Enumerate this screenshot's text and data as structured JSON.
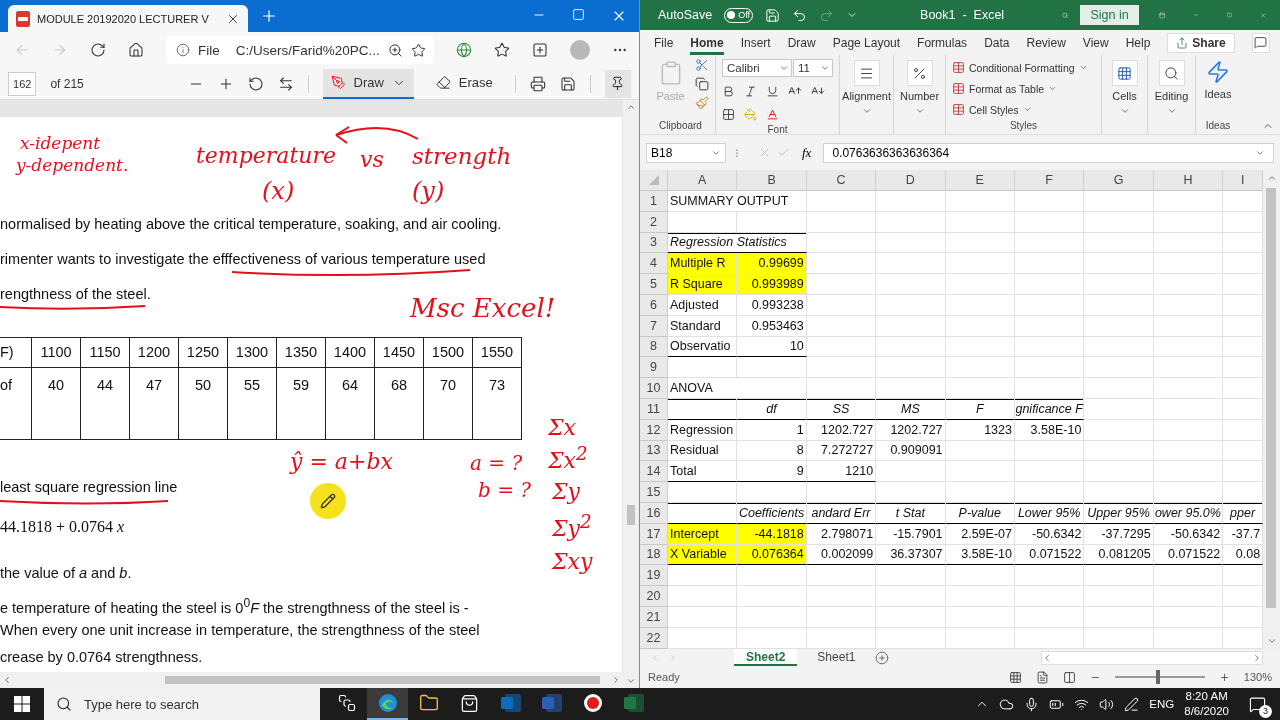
{
  "browser": {
    "tab": {
      "title": "MODULE 20192020 LECTURER V",
      "selected": true
    },
    "nav": {
      "back_disabled": true,
      "forward_disabled": true
    },
    "address": {
      "scheme": "File",
      "url": "C:/Users/Farid%20PC..."
    },
    "pdf_toolbar": {
      "page": "162",
      "page_count": "of 215",
      "tools": [
        {
          "label": "Draw",
          "selected": true
        },
        {
          "label": "Erase",
          "selected": false
        }
      ],
      "pinned": true
    },
    "page": {
      "lines_before_table": [
        "normalised by heating above the critical temperature, soaking, and air cooling.",
        "rimenter wants to investigate the efffectiveness of various temperature used",
        "rengthness of the steel."
      ],
      "table": [
        [
          "F)",
          "1100",
          "1150",
          "1200",
          "1250",
          "1300",
          "1350",
          "1400",
          "1450",
          "1500",
          "1550"
        ],
        [
          "of",
          "40",
          "44",
          "47",
          "50",
          "55",
          "59",
          "64",
          "68",
          "70",
          "73"
        ]
      ],
      "lines_after_table": [
        {
          "kind": "text",
          "text": "least square regression line"
        },
        {
          "kind": "formula",
          "text": "44.1818 + 0.0764 *x*"
        },
        {
          "kind": "text",
          "text": "the value of *a* and *b*."
        },
        {
          "kind": "text",
          "text": "e temperature of heating the steel is  0$^{0}$*F* the strengthness of the steel is -"
        },
        {
          "kind": "text",
          "text": "When every one unit increase in temperature, the strengthness of the steel"
        },
        {
          "kind": "text",
          "text": "crease by 0.0764 strengthness."
        }
      ],
      "ink": [
        "x-idepent",
        "y-dependent.",
        "temperature",
        "vs",
        "strength",
        "(x)",
        "(y)",
        "Msc Excel!",
        "ŷ = a+bx",
        "a = ?",
        "b = ?",
        "Σx",
        "Σx$^{2}$",
        "Σy",
        "Σy$^{2}$",
        "Σxy"
      ]
    }
  },
  "excel": {
    "title_bar": {
      "autosave": "AutoSave",
      "autosave_on": false,
      "autosave_state": "Off",
      "redo_disabled": true,
      "title": "Book1  -  Excel",
      "sign_in": "Sign in"
    },
    "ribbon_tabs": [
      {
        "label": "File",
        "selected": false
      },
      {
        "label": "Home",
        "selected": true
      },
      {
        "label": "Insert",
        "selected": false
      },
      {
        "label": "Draw",
        "selected": false
      },
      {
        "label": "Page Layout",
        "selected": false
      },
      {
        "label": "Formulas",
        "selected": false
      },
      {
        "label": "Data",
        "selected": false
      },
      {
        "label": "Review",
        "selected": false
      },
      {
        "label": "View",
        "selected": false
      },
      {
        "label": "Help",
        "selected": false
      }
    ],
    "share": "Share",
    "ribbon": {
      "paste": "Paste",
      "paste_disabled": true,
      "font": "Calibri",
      "size": "11",
      "alignment": "Alignment",
      "number": "Number",
      "styles": [
        "Conditional Formatting",
        "Format as Table",
        "Cell Styles"
      ],
      "cells": "Cells",
      "editing": "Editing",
      "ideas": "Ideas",
      "groups": [
        "Clipboard",
        "Font",
        "Styles",
        "Ideas"
      ]
    },
    "formula_bar": {
      "name_box": "B18",
      "fx": "fx",
      "formula": "0.0763636363636364"
    },
    "columns": [
      "A",
      "B",
      "C",
      "D",
      "E",
      "F",
      "G",
      "H",
      "I"
    ],
    "rows": [
      {
        "number": "1",
        "kind": "title",
        "highlight": false,
        "border_top": false,
        "border_bottom": false,
        "a": "SUMMARY OUTPUT"
      },
      {
        "number": "2",
        "kind": "blank",
        "highlight": false,
        "border_top": false,
        "border_bottom": false
      },
      {
        "number": "3",
        "kind": "italic-title",
        "highlight": false,
        "border_top": true,
        "border_bottom": true,
        "a": "Regression Statistics"
      },
      {
        "number": "4",
        "kind": "data",
        "highlight": true,
        "border_top": false,
        "border_bottom": false,
        "a": "Multiple R",
        "b": "0.99699"
      },
      {
        "number": "5",
        "kind": "data",
        "highlight": true,
        "border_top": false,
        "border_bottom": false,
        "a": "R Square",
        "b": "0.993989"
      },
      {
        "number": "6",
        "kind": "data",
        "highlight": false,
        "border_top": false,
        "border_bottom": false,
        "a": "Adjusted",
        "b": "0.993238"
      },
      {
        "number": "7",
        "kind": "data",
        "highlight": false,
        "border_top": false,
        "border_bottom": false,
        "a": "Standard",
        "b": "0.953463"
      },
      {
        "number": "8",
        "kind": "data",
        "highlight": false,
        "border_top": false,
        "border_bottom": true,
        "a": "Observatio",
        "b": "10"
      },
      {
        "number": "9",
        "kind": "blank",
        "highlight": false,
        "border_top": false,
        "border_bottom": false
      },
      {
        "number": "10",
        "kind": "title",
        "highlight": false,
        "border_top": false,
        "border_bottom": false,
        "a": "ANOVA"
      },
      {
        "number": "11",
        "kind": "header",
        "highlight": false,
        "border_top": true,
        "border_bottom": true,
        "b": "df",
        "c": "SS",
        "d": "MS",
        "e": "F",
        "f": "gnificance F"
      },
      {
        "number": "12",
        "kind": "data",
        "highlight": false,
        "border_top": false,
        "border_bottom": false,
        "a": "Regression",
        "b": "1",
        "c": "1202.727",
        "d": "1202.727",
        "e": "1323",
        "f": "3.58E-10"
      },
      {
        "number": "13",
        "kind": "data",
        "highlight": false,
        "border_top": false,
        "border_bottom": false,
        "a": "Residual",
        "b": "8",
        "c": "7.272727",
        "d": "0.909091"
      },
      {
        "number": "14",
        "kind": "data",
        "highlight": false,
        "border_top": false,
        "border_bottom": true,
        "a": "Total",
        "b": "9",
        "c": "1210"
      },
      {
        "number": "15",
        "kind": "blank",
        "highlight": false,
        "border_top": false,
        "border_bottom": false
      },
      {
        "number": "16",
        "kind": "header",
        "highlight": false,
        "border_top": true,
        "border_bottom": true,
        "b": "Coefficients",
        "c": "andard Err",
        "d": "t Stat",
        "e": "P-value",
        "f": "Lower 95%",
        "g": "Upper 95%",
        "h": "ower 95.0%",
        "i": "pper"
      },
      {
        "number": "17",
        "kind": "data",
        "highlight": true,
        "border_top": false,
        "border_bottom": false,
        "a": "Intercept",
        "b": "-44.1818",
        "c": "2.798071",
        "d": "-15.7901",
        "e": "2.59E-07",
        "f": "-50.6342",
        "g": "-37.7295",
        "h": "-50.6342",
        "i": "-37.7"
      },
      {
        "number": "18",
        "kind": "data",
        "highlight": true,
        "border_top": false,
        "border_bottom": true,
        "a": "X Variable",
        "b": "0.076364",
        "c": "0.002099",
        "d": "36.37307",
        "e": "3.58E-10",
        "f": "0.071522",
        "g": "0.081205",
        "h": "0.071522",
        "i": "0.08"
      },
      {
        "number": "19",
        "kind": "blank",
        "highlight": false,
        "border_top": false,
        "border_bottom": false
      },
      {
        "number": "20",
        "kind": "blank",
        "highlight": false,
        "border_top": false,
        "border_bottom": false
      },
      {
        "number": "21",
        "kind": "blank",
        "highlight": false,
        "border_top": false,
        "border_bottom": false
      },
      {
        "number": "22",
        "kind": "blank",
        "highlight": false,
        "border_top": false,
        "border_bottom": false
      }
    ],
    "sheet_tabs": [
      {
        "label": "Sheet2",
        "selected": true
      },
      {
        "label": "Sheet1",
        "selected": false
      }
    ],
    "status": {
      "text": "Ready",
      "zoom": "130%",
      "level": 0.48
    }
  },
  "taskbar": {
    "search_placeholder": "Type here to search",
    "apps": [
      {
        "kind": "task-view",
        "selected": false
      },
      {
        "kind": "edge",
        "selected": true
      },
      {
        "kind": "folder",
        "selected": false
      },
      {
        "kind": "store",
        "selected": false
      },
      {
        "kind": "outlook",
        "selected": false
      },
      {
        "kind": "word",
        "selected": false
      },
      {
        "kind": "record",
        "selected": false
      },
      {
        "kind": "excel",
        "selected": false
      }
    ],
    "language": "ENG",
    "time": "8:20 AM",
    "date": "8/6/2020",
    "notifications": "3"
  }
}
